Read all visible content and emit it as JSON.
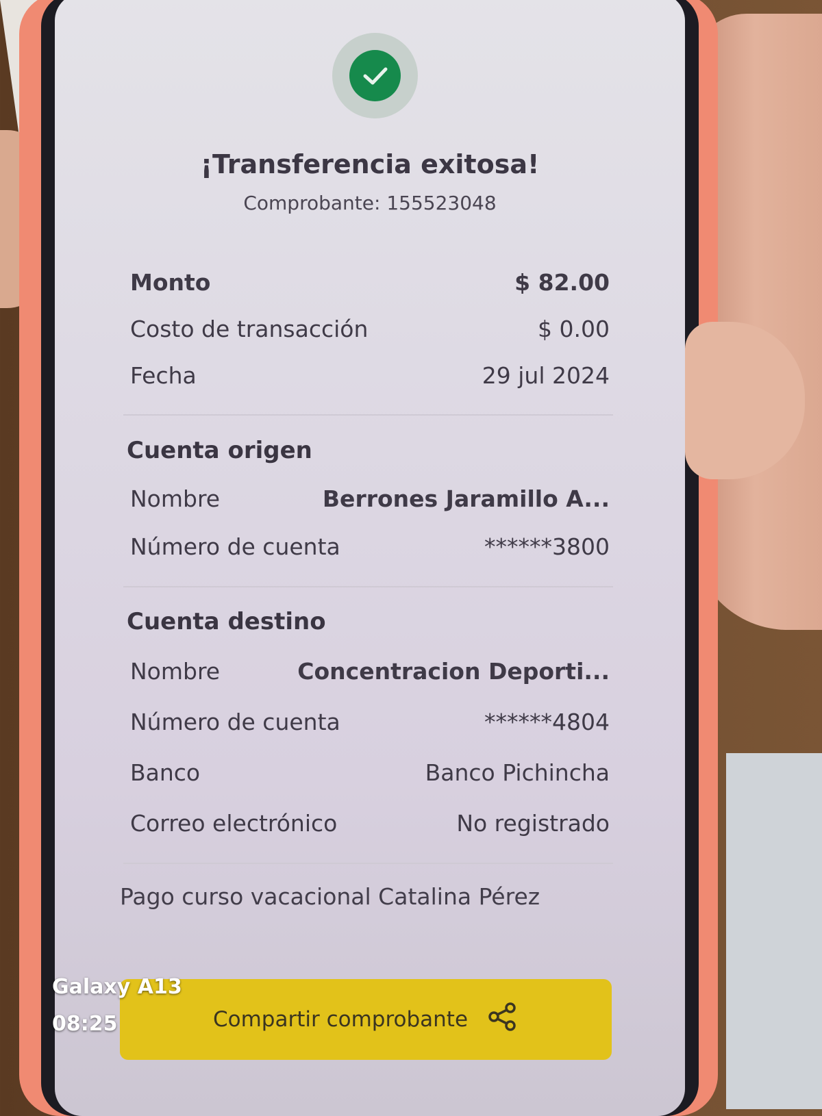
{
  "receipt": {
    "title": "¡Transferencia exitosa!",
    "comprobante": "Comprobante: 155523048"
  },
  "summary": {
    "monto_label": "Monto",
    "monto_value": "$ 82.00",
    "costo_label": "Costo de transacción",
    "costo_value": "$ 0.00",
    "fecha_label": "Fecha",
    "fecha_value": "29 jul 2024"
  },
  "origen": {
    "section_title": "Cuenta origen",
    "nombre_label": "Nombre",
    "nombre_value": "Berrones  Jaramillo A...",
    "cuenta_label": "Número de cuenta",
    "cuenta_value": "******3800"
  },
  "destino": {
    "section_title": "Cuenta destino",
    "nombre_label": "Nombre",
    "nombre_value": "Concentracion Deporti...",
    "cuenta_label": "Número de cuenta",
    "cuenta_value": "******4804",
    "banco_label": "Banco",
    "banco_value": "Banco Pichincha",
    "correo_label": "Correo electrónico",
    "correo_value": "No registrado"
  },
  "description": "Pago curso vacacional Catalina Pérez",
  "share_button": {
    "label": "Compartir comprobante",
    "icon": "share-icon"
  },
  "camera_overlay": {
    "device": "Galaxy A13",
    "time": "08:25"
  },
  "colors": {
    "success": "#168a4c",
    "button": "#e2c21a",
    "case": "#f08a72"
  }
}
